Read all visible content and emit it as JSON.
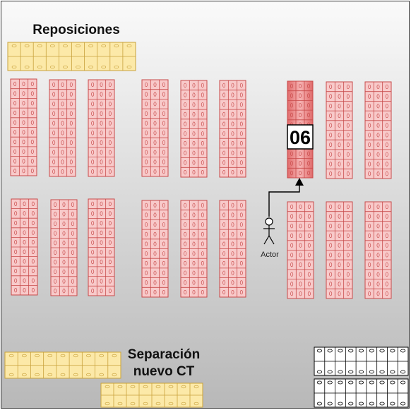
{
  "labels": {
    "reposiciones": "Reposiciones",
    "separacion_line1": "Separación",
    "separacion_line2": "nuevo CT",
    "actor": "Actor",
    "highlight_number": "06"
  },
  "colors": {
    "background_top": "#fafafa",
    "background_bottom": "#b8b8b8",
    "frame_border": "#333333",
    "rack_fill": "#f8caca",
    "rack_stroke": "#c84a4a",
    "rack_highlight_fill": "#ec8a8a",
    "pallet_fill": "#fce9a8",
    "pallet_stroke": "#c9a23c",
    "white_rack_fill": "#ffffff",
    "white_rack_stroke": "#000000",
    "arrow": "#000000"
  },
  "layout_info": {
    "rack_columns": 3,
    "highlighted_rack": "06",
    "icons": [
      "actor-icon",
      "arrow-icon"
    ]
  }
}
